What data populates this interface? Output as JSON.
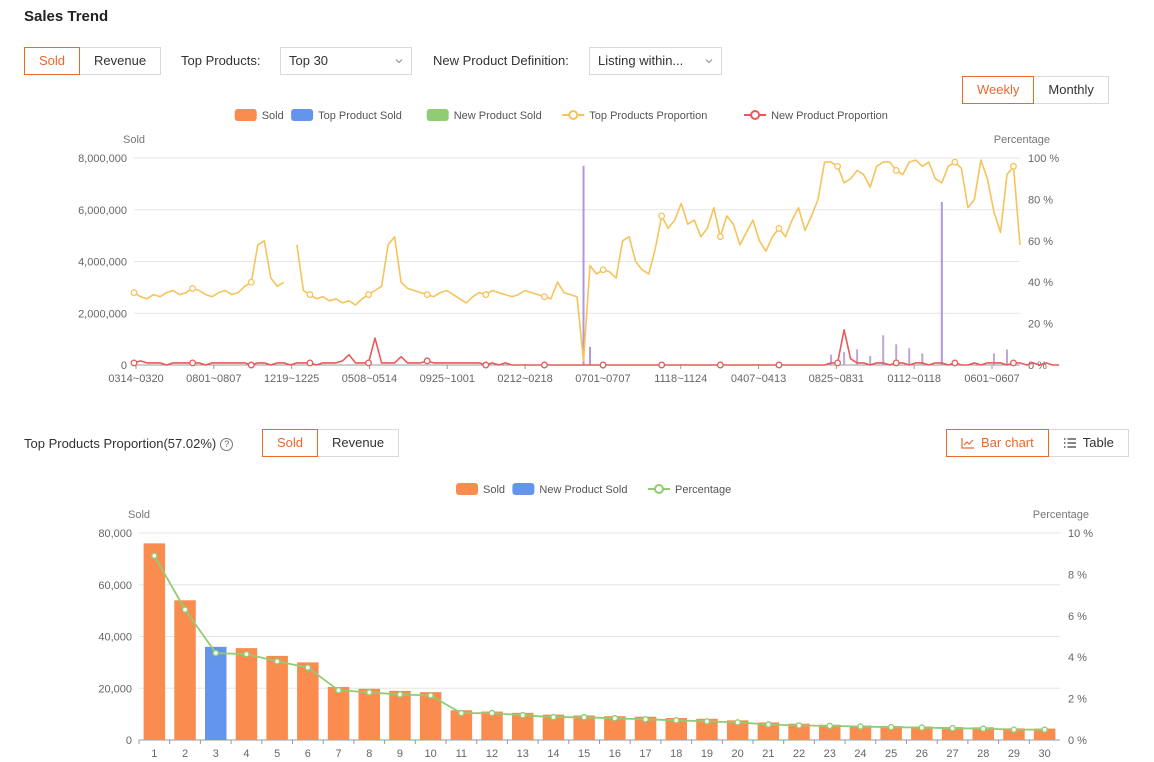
{
  "section1": {
    "title": "Sales Trend",
    "metric_tabs": [
      {
        "label": "Sold",
        "active": true
      },
      {
        "label": "Revenue",
        "active": false
      }
    ],
    "top_products_label": "Top Products:",
    "top_products_value": "Top 30",
    "new_product_label": "New Product Definition:",
    "new_product_value": "Listing within...",
    "period_tabs": [
      {
        "label": "Weekly",
        "active": true
      },
      {
        "label": "Monthly",
        "active": false
      }
    ]
  },
  "section2": {
    "title": "Top Products Proportion(57.02%)",
    "metric_tabs": [
      {
        "label": "Sold",
        "active": true
      },
      {
        "label": "Revenue",
        "active": false
      }
    ],
    "view_tabs": [
      {
        "label": "Bar chart",
        "icon": "line-chart-icon",
        "active": true
      },
      {
        "label": "Table",
        "icon": "list-icon",
        "active": false
      }
    ]
  },
  "colors": {
    "accent": "#e8692c",
    "sold": "#fa8c50",
    "top_sold": "#6495ed",
    "new_sold": "#91cc75",
    "top_prop": "#f5c35a",
    "new_prop": "#e85a5a"
  },
  "chart_data": [
    {
      "type": "line",
      "legend": [
        "Sold",
        "Top Product Sold",
        "New Product Sold",
        "Top Products Proportion",
        "New Product Proportion"
      ],
      "ylabel": "Sold",
      "y2label": "Percentage",
      "ylim": [
        0,
        8000000
      ],
      "y_ticks": [
        "8,000,000",
        "6,000,000",
        "4,000,000",
        "2,000,000",
        "0"
      ],
      "y2lim": [
        0,
        100
      ],
      "y2_ticks": [
        "100 %",
        "80 %",
        "60 %",
        "40 %",
        "20 %",
        "0 %"
      ],
      "x_ticks": [
        "0314~0320",
        "0801~0807",
        "1219~1225",
        "0508~0514",
        "0925~1001",
        "0212~0218",
        "0701~0707",
        "1118~1124",
        "0407~0413",
        "0825~0831",
        "0112~0118",
        "0601~0607"
      ],
      "series": [
        {
          "name": "Top Products Proportion",
          "axis": "right",
          "unit": "%",
          "values": [
            35,
            33,
            32,
            34,
            33,
            35,
            36,
            34,
            35,
            37,
            36,
            34,
            33,
            35,
            36,
            34,
            35,
            38,
            40,
            58,
            60,
            42,
            38,
            40,
            null,
            58,
            36,
            34,
            32,
            33,
            31,
            32,
            30,
            31,
            29,
            32,
            34,
            36,
            38,
            58,
            62,
            40,
            37,
            36,
            35,
            34,
            33,
            35,
            36,
            34,
            32,
            30,
            33,
            35,
            34,
            36,
            35,
            34,
            33,
            34,
            36,
            35,
            34,
            33,
            32,
            40,
            35,
            34,
            33,
            2,
            48,
            44,
            46,
            45,
            42,
            60,
            62,
            50,
            46,
            44,
            56,
            72,
            66,
            70,
            78,
            68,
            70,
            62,
            66,
            76,
            62,
            72,
            68,
            58,
            64,
            70,
            60,
            55,
            62,
            66,
            62,
            70,
            76,
            65,
            72,
            80,
            98,
            98,
            96,
            88,
            90,
            94,
            92,
            86,
            96,
            98,
            98,
            94,
            92,
            98,
            99,
            96,
            98,
            90,
            88,
            96,
            98,
            95,
            76,
            80,
            99,
            90,
            74,
            64,
            92,
            96,
            58
          ]
        },
        {
          "name": "New Product Proportion",
          "axis": "right",
          "unit": "%",
          "values": [
            1,
            2,
            1,
            1,
            1,
            0,
            1,
            1,
            1,
            1,
            1,
            0,
            1,
            1,
            1,
            1,
            1,
            1,
            0,
            1,
            1,
            0,
            1,
            1,
            0,
            1,
            1,
            1,
            0,
            1,
            1,
            1,
            2,
            5,
            1,
            1,
            1,
            13,
            1,
            1,
            1,
            4,
            1,
            1,
            1,
            2,
            1,
            1,
            1,
            1,
            1,
            1,
            1,
            1,
            0,
            1,
            0,
            1,
            0,
            0,
            0,
            0,
            0,
            0,
            0,
            0,
            0,
            0,
            0,
            0,
            0,
            0,
            0,
            0,
            0,
            0,
            0,
            0,
            0,
            0,
            0,
            0,
            0,
            0,
            0,
            0,
            0,
            0,
            0,
            0,
            0,
            0,
            0,
            0,
            0,
            0,
            0,
            0,
            0,
            0,
            0,
            0,
            0,
            0,
            0,
            0,
            0,
            1,
            1,
            17,
            3,
            1,
            1,
            0,
            1,
            1,
            0,
            1,
            1,
            0,
            1,
            1,
            0,
            1,
            1,
            0,
            1,
            0,
            0,
            1,
            0,
            1,
            1,
            1,
            0,
            1,
            1,
            0,
            1,
            0,
            1,
            0,
            0
          ]
        },
        {
          "name": "Top Product Sold",
          "axis": "left",
          "spikes": [
            {
              "i": 69,
              "v": 7700000
            },
            {
              "i": 70,
              "v": 700000
            },
            {
              "i": 124,
              "v": 6300000
            }
          ]
        },
        {
          "name": "Sold",
          "axis": "left",
          "spikes": [
            {
              "i": 107,
              "v": 400000
            },
            {
              "i": 109,
              "v": 500000
            },
            {
              "i": 111,
              "v": 600000
            },
            {
              "i": 113,
              "v": 350000
            },
            {
              "i": 115,
              "v": 1150000
            },
            {
              "i": 117,
              "v": 800000
            },
            {
              "i": 119,
              "v": 650000
            },
            {
              "i": 121,
              "v": 450000
            },
            {
              "i": 132,
              "v": 450000
            },
            {
              "i": 134,
              "v": 600000
            }
          ]
        }
      ]
    },
    {
      "type": "bar",
      "legend": [
        "Sold",
        "New Product Sold",
        "Percentage"
      ],
      "ylabel": "Sold",
      "y2label": "Percentage",
      "ylim": [
        0,
        80000
      ],
      "y_ticks": [
        "80,000",
        "60,000",
        "40,000",
        "20,000",
        "0"
      ],
      "y2lim": [
        0,
        10
      ],
      "y2_ticks": [
        "10 %",
        "8 %",
        "6 %",
        "4 %",
        "2 %",
        "0 %"
      ],
      "categories": [
        "1",
        "2",
        "3",
        "4",
        "5",
        "6",
        "7",
        "8",
        "9",
        "10",
        "11",
        "12",
        "13",
        "14",
        "15",
        "16",
        "17",
        "18",
        "19",
        "20",
        "21",
        "22",
        "23",
        "24",
        "25",
        "26",
        "27",
        "28",
        "29",
        "30"
      ],
      "series": [
        {
          "name": "Sold",
          "values": [
            76000,
            54000,
            36000,
            35500,
            32500,
            30000,
            20500,
            19800,
            19000,
            18500,
            11500,
            11000,
            10500,
            9800,
            9500,
            9200,
            9000,
            8500,
            8200,
            7600,
            6800,
            6300,
            5900,
            5600,
            5400,
            5200,
            5000,
            4900,
            4500,
            4400
          ]
        },
        {
          "name": "Percentage",
          "values": [
            8.9,
            6.3,
            4.2,
            4.15,
            3.8,
            3.5,
            2.4,
            2.3,
            2.2,
            2.15,
            1.3,
            1.3,
            1.2,
            1.1,
            1.1,
            1.05,
            1.0,
            0.95,
            0.9,
            0.85,
            0.75,
            0.7,
            0.68,
            0.65,
            0.62,
            0.6,
            0.57,
            0.55,
            0.5,
            0.5
          ]
        }
      ],
      "new_product_indices": [
        2
      ]
    }
  ]
}
